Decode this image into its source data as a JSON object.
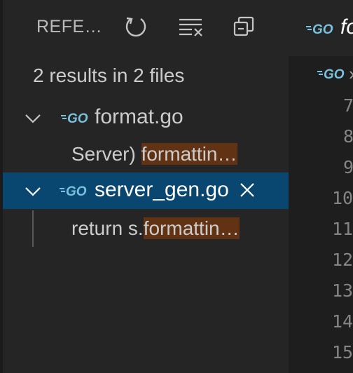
{
  "references_panel": {
    "title": "REFE…",
    "actions": [
      {
        "name": "refresh-icon"
      },
      {
        "name": "clear-all-icon"
      },
      {
        "name": "collapse-all-icon"
      }
    ],
    "summary": "2 results in 2 files",
    "files": [
      {
        "name": "format.go",
        "expanded": true,
        "selected": false,
        "match": {
          "before": "Server) ",
          "highlight": "formattin…"
        }
      },
      {
        "name": "server_gen.go",
        "expanded": true,
        "selected": true,
        "match": {
          "before": "return s.",
          "highlight": "formattin…"
        }
      }
    ]
  },
  "editor": {
    "tab_label": "fo",
    "breadcrumb_sep": "›",
    "line_numbers": [
      "7",
      "8",
      "9",
      "10",
      "11",
      "12",
      "13",
      "14",
      "15"
    ]
  },
  "colors": {
    "selection": "#094771",
    "match_highlight": "#613214",
    "go_logo": "#79c1dc"
  }
}
